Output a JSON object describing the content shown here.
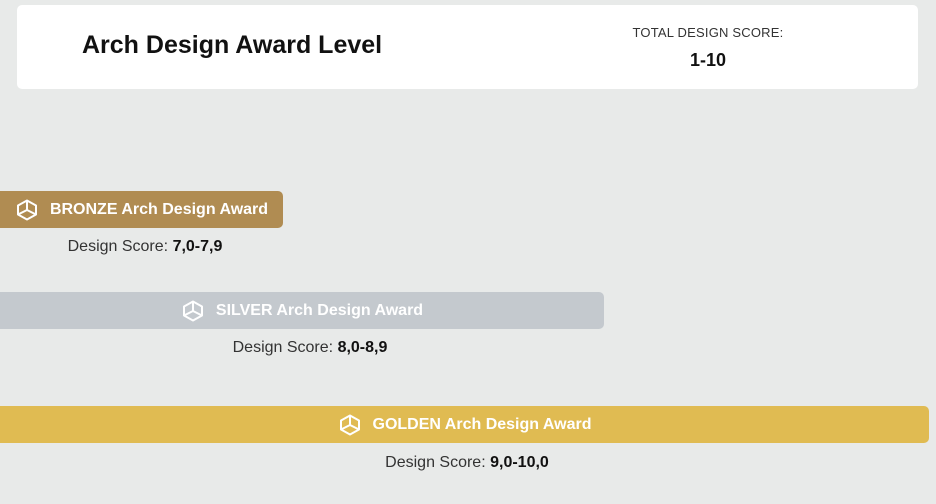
{
  "header": {
    "title": "Arch Design Award Level",
    "score_caption": "TOTAL DESIGN SCORE:",
    "score_range": "1-10"
  },
  "colors": {
    "background": "#e8eae9",
    "bronze": "#b08c52",
    "silver": "#c4c9ce",
    "golden": "#e0bb52"
  },
  "tiers": [
    {
      "label": "BRONZE Arch Design Award",
      "score_label": "Design Score:",
      "score_value": "7,0-7,9",
      "icon": "award-icon"
    },
    {
      "label": "SILVER Arch Design Award",
      "score_label": "Design Score:",
      "score_value": "8,0-8,9",
      "icon": "award-icon"
    },
    {
      "label": "GOLDEN Arch Design Award",
      "score_label": "Design Score:",
      "score_value": "9,0-10,0",
      "icon": "award-icon"
    }
  ]
}
